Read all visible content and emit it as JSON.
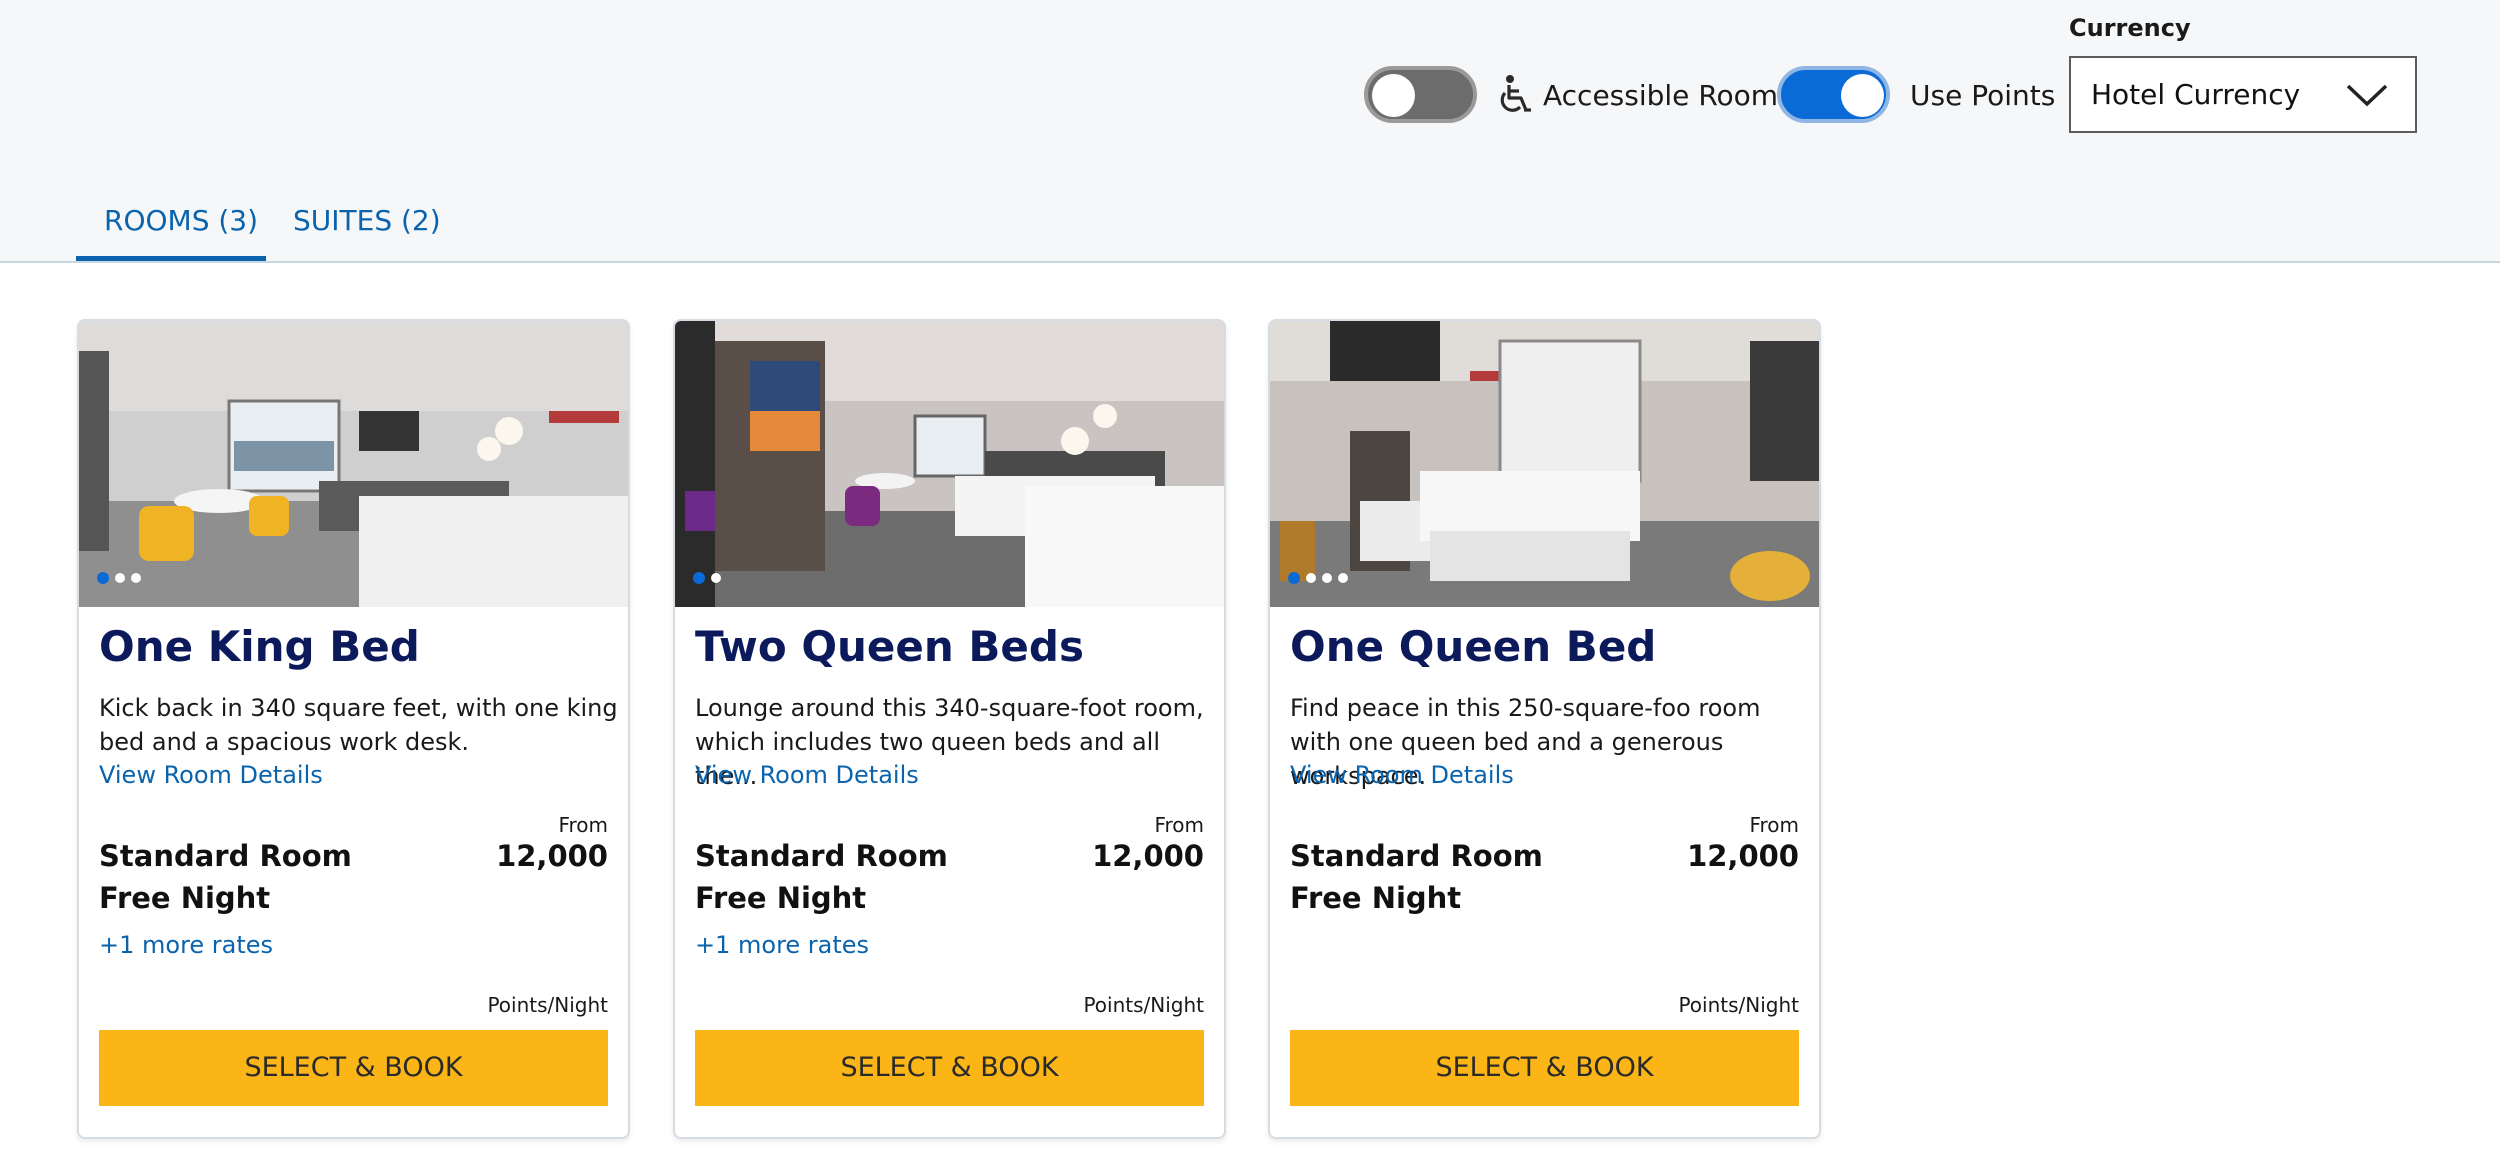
{
  "filters": {
    "accessible_room": {
      "label": "Accessible Room",
      "on": false
    },
    "use_points": {
      "label": "Use Points",
      "on": true
    },
    "currency": {
      "title": "Currency",
      "value": "Hotel Currency"
    }
  },
  "tabs": [
    {
      "label": "ROOMS (3)",
      "active": true
    },
    {
      "label": "SUITES (2)",
      "active": false
    }
  ],
  "rooms": [
    {
      "title": "One King Bed",
      "description": "Kick back in 340 square feet, with one king bed and a spacious work desk.",
      "details_link": "View Room Details",
      "from_label": "From",
      "rate_name": "Standard Room Free Night",
      "price": "12,000",
      "more_rates": "+1 more rates",
      "unit": "Points/Night",
      "button": "SELECT & BOOK",
      "photo_count": 3
    },
    {
      "title": "Two Queen Beds",
      "description": "Lounge around this 340-square-foot room, which includes two queen beds and all the...",
      "details_link": "View Room Details",
      "from_label": "From",
      "rate_name": "Standard Room Free Night",
      "price": "12,000",
      "more_rates": "+1 more rates",
      "unit": "Points/Night",
      "button": "SELECT & BOOK",
      "photo_count": 2
    },
    {
      "title": "One Queen Bed",
      "description": "Find peace in this 250-square-foo room with one queen bed and a generous workspace.",
      "details_link": "View Room Details",
      "from_label": "From",
      "rate_name": "Standard Room Free Night",
      "price": "12,000",
      "more_rates": "",
      "unit": "Points/Night",
      "button": "SELECT & BOOK",
      "photo_count": 4
    }
  ],
  "colors": {
    "accent": "#0a63ad",
    "title": "#0c1a5c",
    "button": "#fbb516",
    "toggle_on": "#0a6bd6",
    "toggle_off": "#6c6c6c"
  }
}
